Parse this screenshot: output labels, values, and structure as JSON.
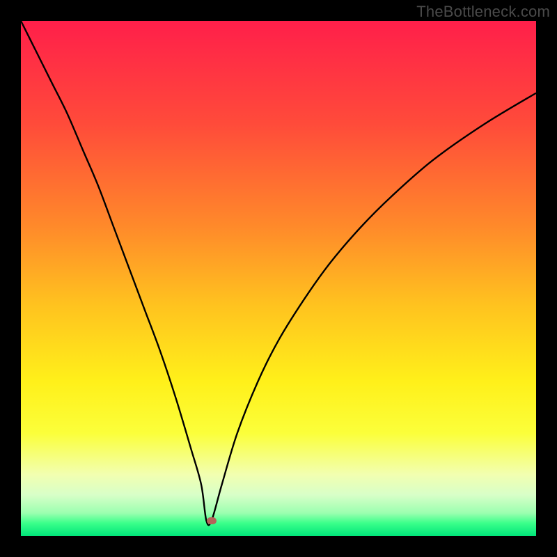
{
  "watermark": "TheBottleneck.com",
  "colors": {
    "bg_black": "#000000",
    "curve": "#000000",
    "marker": "#b56359",
    "gradient_stops": [
      {
        "pos": 0.0,
        "color": "#ff1f4a"
      },
      {
        "pos": 0.2,
        "color": "#ff4b3a"
      },
      {
        "pos": 0.4,
        "color": "#ff8a2a"
      },
      {
        "pos": 0.55,
        "color": "#ffc21f"
      },
      {
        "pos": 0.7,
        "color": "#fff01a"
      },
      {
        "pos": 0.8,
        "color": "#fbff3a"
      },
      {
        "pos": 0.88,
        "color": "#f2ffb0"
      },
      {
        "pos": 0.92,
        "color": "#d8ffc8"
      },
      {
        "pos": 0.955,
        "color": "#9cffb0"
      },
      {
        "pos": 0.975,
        "color": "#3aff8a"
      },
      {
        "pos": 1.0,
        "color": "#00e57a"
      }
    ]
  },
  "chart_data": {
    "type": "line",
    "title": "",
    "xlabel": "",
    "ylabel": "",
    "xlim": [
      0,
      100
    ],
    "ylim": [
      0,
      100
    ],
    "notch_x": 36,
    "marker": {
      "x": 37,
      "y": 3
    },
    "series": [
      {
        "name": "bottleneck-curve",
        "x": [
          0,
          3,
          6,
          9,
          12,
          15,
          18,
          21,
          24,
          27,
          30,
          33,
          35,
          36,
          37,
          39,
          42,
          46,
          50,
          55,
          60,
          66,
          72,
          80,
          90,
          100
        ],
        "values": [
          100,
          94,
          88,
          82,
          75,
          68,
          60,
          52,
          44,
          36,
          27,
          17,
          10,
          3,
          3,
          10,
          20,
          30,
          38,
          46,
          53,
          60,
          66,
          73,
          80,
          86
        ]
      }
    ]
  }
}
